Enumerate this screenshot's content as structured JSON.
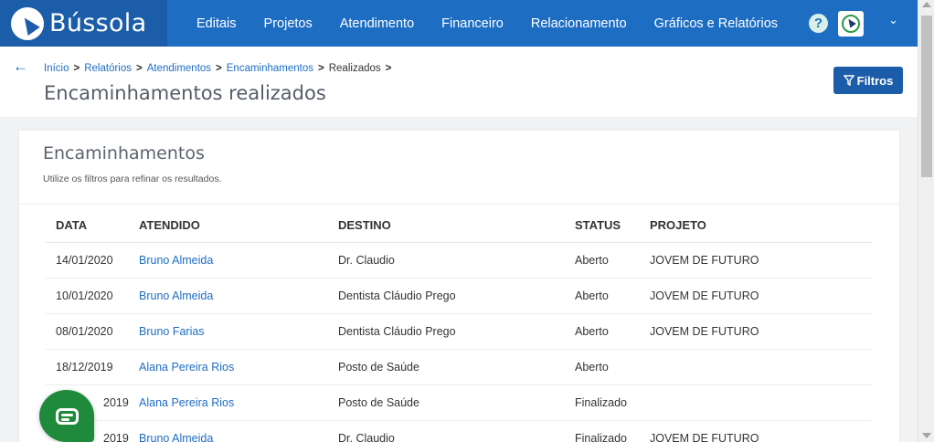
{
  "brand": {
    "name": "Bússola"
  },
  "nav": {
    "items": [
      "Editais",
      "Projetos",
      "Atendimento",
      "Financeiro",
      "Relacionamento",
      "Gráficos e Relatórios"
    ],
    "help_label": "?"
  },
  "breadcrumb": {
    "items": [
      "Início",
      "Relatórios",
      "Atendimentos",
      "Encaminhamentos"
    ],
    "current": "Realizados"
  },
  "page": {
    "title": "Encaminhamentos realizados",
    "filter_label": "Filtros"
  },
  "card": {
    "title": "Encaminhamentos",
    "subtitle": "Utilize os filtros para refinar os resultados."
  },
  "table": {
    "headers": [
      "DATA",
      "ATENDIDO",
      "DESTINO",
      "STATUS",
      "PROJETO"
    ],
    "rows": [
      {
        "data": "14/01/2020",
        "atendido": "Bruno Almeida",
        "destino": "Dr. Claudio",
        "status": "Aberto",
        "projeto": "JOVEM DE FUTURO"
      },
      {
        "data": "10/01/2020",
        "atendido": "Bruno Almeida",
        "destino": "Dentista Cláudio Prego",
        "status": "Aberto",
        "projeto": "JOVEM DE FUTURO"
      },
      {
        "data": "08/01/2020",
        "atendido": "Bruno Farias",
        "destino": "Dentista Cláudio Prego",
        "status": "Aberto",
        "projeto": "JOVEM DE FUTURO"
      },
      {
        "data": "18/12/2019",
        "atendido": "Alana Pereira Rios",
        "destino": "Posto de Saúde",
        "status": "Aberto",
        "projeto": ""
      },
      {
        "data": "2019",
        "atendido": "Alana Pereira Rios",
        "destino": "Posto de Saúde",
        "status": "Finalizado",
        "projeto": ""
      },
      {
        "data": "2019",
        "atendido": "Bruno Almeida",
        "destino": "Dr. Claudio",
        "status": "Finalizado",
        "projeto": "JOVEM DE FUTURO"
      }
    ]
  },
  "colors": {
    "primary": "#1d6dc3",
    "brand_bg": "#1b5da8",
    "chat": "#1f8a3c"
  }
}
